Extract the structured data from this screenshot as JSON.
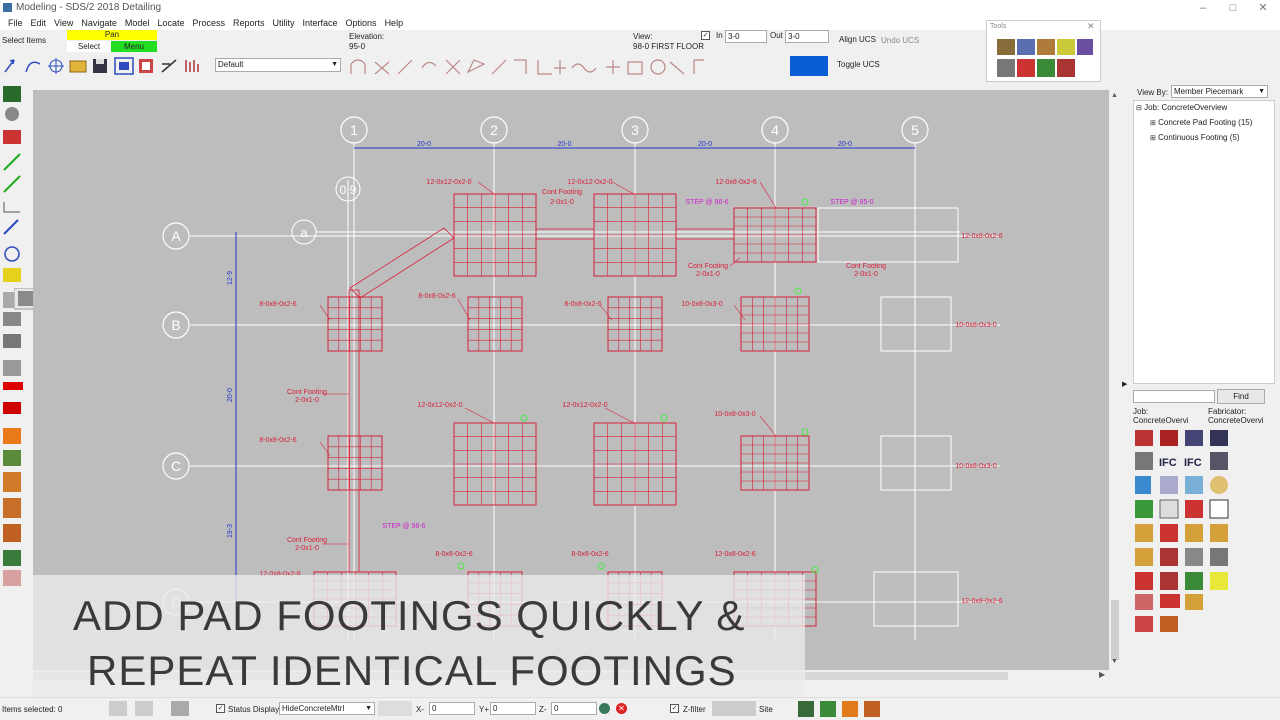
{
  "window": {
    "title": "Modeling - SDS/2 2018 Detailing"
  },
  "menu": [
    "File",
    "Edit",
    "View",
    "Navigate",
    "Model",
    "Locate",
    "Process",
    "Reports",
    "Utility",
    "Interface",
    "Options",
    "Help"
  ],
  "toolbar": {
    "select_items_label": "Select Items",
    "pan_label": "Pan",
    "select_label": "Select",
    "menu_label": "Menu",
    "elevation_label": "Elevation:",
    "elevation_value": "95-0",
    "view_label": "View:",
    "view_value": "98-0 FIRST FLOOR",
    "in_label": "In",
    "in_value": "3-0",
    "out_label": "Out",
    "out_value": "3-0",
    "align_ucs": "Align UCS",
    "undo_ucs": "Undo UCS",
    "toggle_ucs": "Toggle UCS",
    "layer_value": "Default"
  },
  "tools_window": {
    "title": "Tools"
  },
  "drawing": {
    "column_grids": [
      "1",
      "2",
      "3",
      "4",
      "5"
    ],
    "row_grids": [
      "A",
      "B",
      "C",
      "D"
    ],
    "sub_grids": [
      "a",
      "0.9"
    ],
    "dims_top": [
      "20-0",
      "20-0",
      "20-0",
      "20-0"
    ],
    "dims_left": [
      "12-9",
      "20-0",
      "19-3"
    ],
    "labels_red": [
      "12-0x12-0x2-0",
      "12-0x12-0x2-0",
      "12-0x8-0x2-6",
      "Cont Footing",
      "2-0x1-0",
      "Cont Footing",
      "2-0x1-0",
      "Cont Footing",
      "2-0x1-0",
      "12-0x8-0x2-6",
      "8-0x8-0x2-6",
      "8-0x8-0x2-6",
      "8-0x8-0x2-6",
      "10-0x8-0x3-0",
      "10-0x8-0x3-0",
      "Cont Footing",
      "2-0x1-0",
      "12-0x12-0x2-0",
      "12-0x12-0x2-0",
      "10-0x8-0x3-0",
      "8-0x8-0x2-6",
      "10-0x8-0x3-0",
      "Cont Footing",
      "2-0x1-0",
      "8-0x8-0x2-6",
      "8-0x8-0x2-6",
      "12-0x8-0x2-6",
      "12-0x8-0x2-6",
      "12-0x8-0x2-6"
    ],
    "labels_magenta": [
      "STEP @ 96-6",
      "STEP @ 95-0",
      "STEP @ 96-6"
    ]
  },
  "overlay": {
    "line1": "ADD PAD FOOTINGS QUICKLY &",
    "line2": "REPEAT IDENTICAL FOOTINGS"
  },
  "right_panel": {
    "view_by_label": "View By:",
    "view_by_value": "Member Piecemark",
    "tree": [
      {
        "label": "Job: ConcreteOverview"
      },
      {
        "label": "Concrete Pad Footing (15)"
      },
      {
        "label": "Continuous Footing (5)"
      }
    ],
    "find_label": "Find",
    "job_label": "Job:",
    "job_value": "ConcreteOvervi",
    "fabricator_label": "Fabricator:",
    "fabricator_value": "ConcreteOvervi"
  },
  "status": {
    "items_selected": "Items selected: 0",
    "status_display": "Status Display",
    "status_display_value": "HideConcreteMtrl",
    "x_label": "X-",
    "x_value": "0",
    "y_label": "Y+",
    "y_value": "0",
    "z_label": "Z-",
    "z_value": "0",
    "zfilter": "Z-filter",
    "site": "Site"
  },
  "colors": {
    "drawing_bg": "#bdbdbd",
    "grid_line": "#ffffff",
    "dim_blue": "#2233cc",
    "footing_red": "#d8203a",
    "step_magenta": "#cc22cc",
    "toolbar_yellow": "#ffff00",
    "toolbar_green": "#22dd22"
  }
}
